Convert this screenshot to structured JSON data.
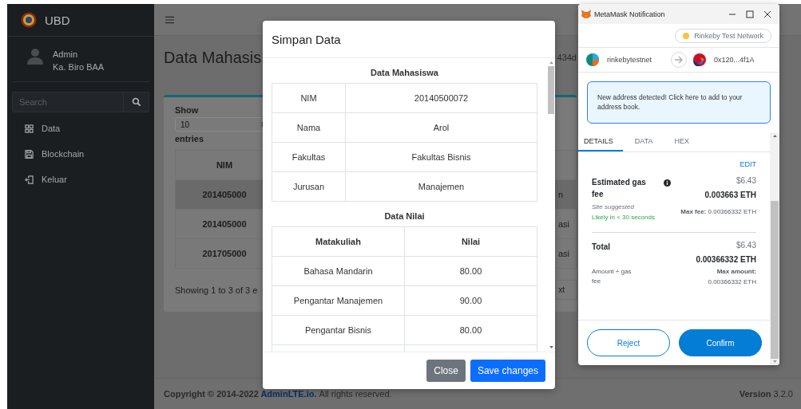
{
  "sidebar": {
    "brand": "UBD",
    "user": {
      "name": "Admin",
      "role": "Ka. Biro BAA"
    },
    "search": {
      "placeholder": "Search"
    },
    "items": [
      {
        "label": "Data"
      },
      {
        "label": "Blockchain"
      },
      {
        "label": "Keluar"
      }
    ]
  },
  "page": {
    "title": "Data Mahasis",
    "title_tail": "434d",
    "length": {
      "label": "Show",
      "value": "10",
      "suffix": "entries"
    },
    "table": {
      "columns": [
        "NIM"
      ],
      "rows": [
        {
          "nim": "201405000",
          "column_2": "n",
          "selected": true
        },
        {
          "nim": "201405000",
          "column_2": "asi",
          "selected": false
        },
        {
          "nim": "201705000",
          "column_2": "asi",
          "selected": false
        }
      ]
    },
    "info": "Showing 1 to 3 of 3 e",
    "pager_next": "xt"
  },
  "footer": {
    "copyright_before": "Copyright © 2014-2022",
    "link": "AdminLTE.io.",
    "copyright_after": "All rights reserved.",
    "version_label": "Version",
    "version": "3.2.0"
  },
  "modal": {
    "title": "Simpan Data",
    "section_1": "Data Mahasiswa",
    "fields": [
      {
        "label": "NIM",
        "value": "20140500072"
      },
      {
        "label": "Nama",
        "value": "Arol"
      },
      {
        "label": "Fakultas",
        "value": "Fakultas Bisnis"
      },
      {
        "label": "Jurusan",
        "value": "Manajemen"
      }
    ],
    "section_2": "Data Nilai",
    "grades": {
      "columns": [
        "Matakuliah",
        "Nilai"
      ],
      "rows": [
        [
          "Bahasa Mandarin",
          "80.00"
        ],
        [
          "Pengantar Manajemen",
          "90.00"
        ],
        [
          "Pengantar Bisnis",
          "80.00"
        ]
      ]
    },
    "buttons": [
      {
        "label": "Close",
        "kind": "secondary"
      },
      {
        "label": "Save changes",
        "kind": "primary"
      }
    ]
  },
  "metamask": {
    "title": "MetaMask Notification",
    "network": "Rinkeby Test Network",
    "from": "rinkebytestnet",
    "to": "0x120...4f1A",
    "alert": "New address detected! Click here to add to your address book.",
    "tabs": [
      {
        "label": "DETAILS",
        "selected": true
      },
      {
        "label": "DATA",
        "selected": false
      },
      {
        "label": "HEX",
        "selected": false
      }
    ],
    "edit": "EDIT",
    "gas": {
      "label": "Estimated gas fee",
      "usd": "$6.43",
      "eth": "0.003663 ETH",
      "note": "Site suggested",
      "timing": "Likely in < 30 seconds",
      "max_label": "Max fee:",
      "max_value": "0.00366332 ETH"
    },
    "total": {
      "label": "Total",
      "usd": "$6.43",
      "eth": "0.00366332 ETH",
      "sub": "Amount + gas fee",
      "max_label": "Max amount:",
      "max_value": "0.00366332 ETH"
    },
    "buttons": [
      {
        "label": "Reject",
        "kind": "secondary"
      },
      {
        "label": "Confirm",
        "kind": "primary"
      }
    ]
  }
}
